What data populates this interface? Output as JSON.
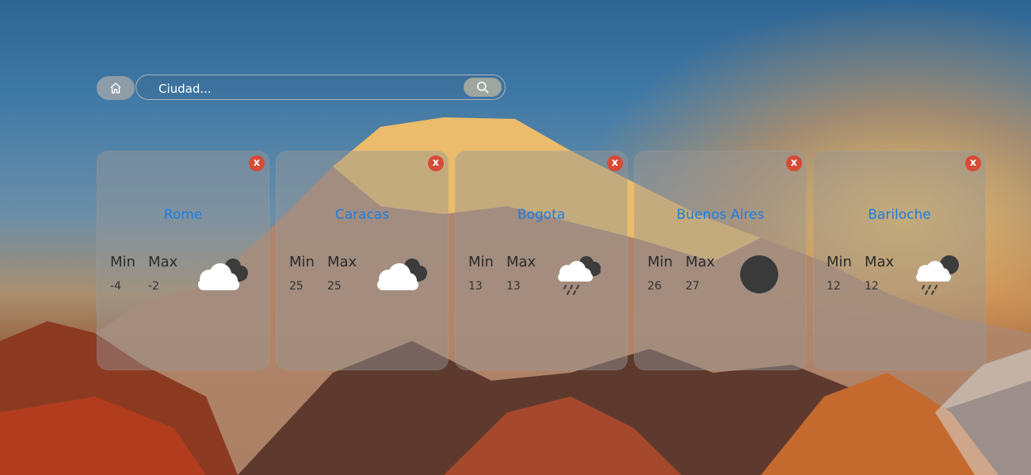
{
  "search": {
    "placeholder": "Ciudad...",
    "home_icon": "home-icon",
    "search_icon": "search-icon"
  },
  "labels": {
    "min": "Min",
    "max": "Max",
    "close": "x"
  },
  "colors": {
    "city_name": "#1e7de0",
    "close_button": "#d64a36"
  },
  "cards": [
    {
      "city": "Rome",
      "min": "-4",
      "max": "-2",
      "icon": "cloudy-icon"
    },
    {
      "city": "Caracas",
      "min": "25",
      "max": "25",
      "icon": "cloudy-icon"
    },
    {
      "city": "Bogota",
      "min": "13",
      "max": "13",
      "icon": "rain-cloud-icon"
    },
    {
      "city": "Buenos Aires",
      "min": "26",
      "max": "27",
      "icon": "clear-night-icon"
    },
    {
      "city": "Bariloche",
      "min": "12",
      "max": "12",
      "icon": "rain-night-icon"
    }
  ]
}
